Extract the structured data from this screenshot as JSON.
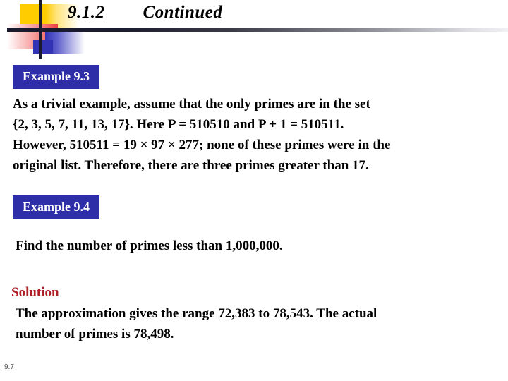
{
  "slide": {
    "title": "9.1.2        Continued",
    "page_number": "9.7",
    "accent_blue": "#2E2EA8",
    "accent_red": "#B01E28",
    "accent_yellow": "#FFCC00"
  },
  "example_93": {
    "label": "Example 9.3",
    "line1": "As a trivial example, assume that the only primes are in the set",
    "line2": "{2, 3, 5, 7, 11, 13, 17}. Here P = 510510 and P + 1 = 510511.",
    "line3": "However, 510511 = 19 × 97 × 277; none of these primes were in the",
    "line4": "original list. Therefore, there are three primes greater than 17."
  },
  "example_94": {
    "label": "Example 9.4",
    "question": "Find the number of primes less than 1,000,000.",
    "solution_heading": "Solution",
    "solution_line1": "The approximation gives the range 72,383 to 78,543. The actual",
    "solution_line2": "number of primes is 78,498."
  }
}
